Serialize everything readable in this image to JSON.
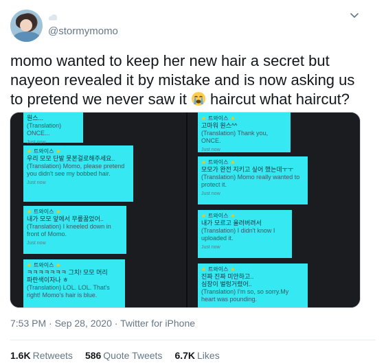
{
  "author": {
    "handle": "@stormymomo"
  },
  "tweet": {
    "text_before_emoji": "momo wanted to keep her new hair a secret but nayeon revealed it by mistake and is now asking us to pretend we never saw it ",
    "emoji": "loudly-crying-face",
    "text_after_emoji": " haircut what haircut?"
  },
  "media": {
    "left_panel": [
      {
        "lines": [
          "원스..."
        ],
        "translation": "(Translation) ONCE...",
        "time": "Just now"
      },
      {
        "sender": "트와이스",
        "lines": [
          "우리 모모 단발 못본걸로해주세요.."
        ],
        "translation": "(Translation) Momo, please pretend you didn't see my bobbed hair.",
        "time": "Just now"
      },
      {
        "sender": "트와이스",
        "lines": [
          "내가 모모 앞에서 무릎꿇었어.."
        ],
        "translation": "(Translation) I kneeled down in front of Momo.",
        "time": "Just now"
      },
      {
        "sender": "트와이스",
        "lines": [
          "ㅋㅋㅋㅋㅋㅋㅋ 그치! 모모 머리",
          "파란색이자나 ㅎ"
        ],
        "translation": "(Translation) LOL. LOL. That's right! Momo's hair is blue.",
        "time": ""
      }
    ],
    "right_panel": [
      {
        "sender": "트와이스",
        "lines": [
          "고마워 원스^^"
        ],
        "translation": "(Translation) Thank you, ONCE.",
        "time": "Just now"
      },
      {
        "sender": "트와이스",
        "lines": [
          "모모가 완전 지키고 싶어 했는데ㅜㅜ"
        ],
        "translation": "(Translation) Momo really wanted to protect it.",
        "time": "Just now"
      },
      {
        "sender": "트와이스",
        "lines": [
          "내가 모르고 올려버려서"
        ],
        "translation": "(Translation) I didn't know I uploaded it.",
        "time": "Just now"
      },
      {
        "sender": "트와이스",
        "lines": [
          "진짜 진짜 미안하고..",
          "심장이 벌렁거렸어.."
        ],
        "translation": "(Translation) I'm so, so sorry.My heart was pounding.",
        "time": ""
      }
    ]
  },
  "meta": {
    "time_date": "7:53 PM · Sep 28, 2020 · ",
    "client": "Twitter for iPhone"
  },
  "stats": {
    "retweets_count": "1.6K",
    "retweets_label": "Retweets",
    "quotes_count": "586",
    "quotes_label": "Quote Tweets",
    "likes_count": "6.7K",
    "likes_label": "Likes"
  }
}
